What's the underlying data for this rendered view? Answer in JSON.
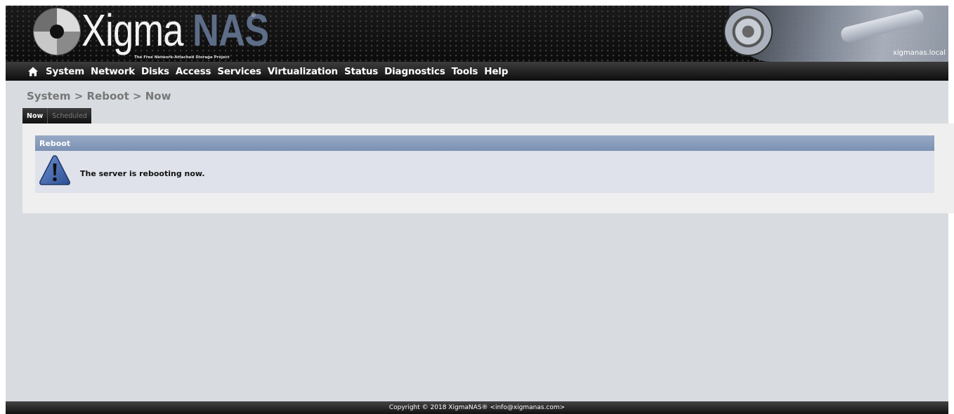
{
  "header": {
    "logo_text_light": "Xigma",
    "logo_text_dark": "NAS",
    "logo_registered": "®",
    "tagline": "The Free Network-Attached Storage Project",
    "hostname": "xigmanas.local"
  },
  "nav": {
    "items": [
      "System",
      "Network",
      "Disks",
      "Access",
      "Services",
      "Virtualization",
      "Status",
      "Diagnostics",
      "Tools",
      "Help"
    ]
  },
  "page": {
    "breadcrumb": "System > Reboot > Now",
    "tabs": [
      {
        "label": "Now",
        "active": true
      },
      {
        "label": "Scheduled",
        "active": false
      }
    ]
  },
  "section": {
    "title": "Reboot",
    "icon": "warning-icon",
    "message": "The server is rebooting now."
  },
  "footer": {
    "text": "Copyright © 2018 XigmaNAS® <info@xigmanas.com>"
  },
  "colors": {
    "section_header": "#8a9ebe",
    "accent_logo": "#5d6c87",
    "background": "#d8dbe0"
  }
}
